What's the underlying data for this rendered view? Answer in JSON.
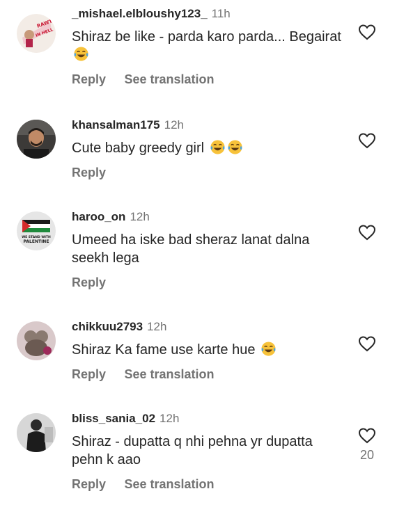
{
  "comments": [
    {
      "username": "_mishael.elbloushy123_",
      "time": "11h",
      "text": "Shiraz be like - parda karo parda... Begairat",
      "emojis": 1,
      "actions": [
        "Reply",
        "See translation"
      ],
      "like_count": "",
      "avatar_text": [
        "RAWT",
        "IN HELL"
      ]
    },
    {
      "username": "khansalman175",
      "time": "12h",
      "text": "Cute baby greedy girl",
      "emojis": 2,
      "actions": [
        "Reply"
      ],
      "like_count": ""
    },
    {
      "username": "haroo_on",
      "time": "12h",
      "text": "Umeed ha iske bad sheraz lanat dalna seekh lega",
      "emojis": 0,
      "actions": [
        "Reply"
      ],
      "like_count": "",
      "avatar_text": [
        "WE STAND WITH",
        "PALENTINE"
      ]
    },
    {
      "username": "chikkuu2793",
      "time": "12h",
      "text": "Shiraz Ka fame use karte hue",
      "emojis": 1,
      "actions": [
        "Reply",
        "See translation"
      ],
      "like_count": ""
    },
    {
      "username": "bliss_sania_02",
      "time": "12h",
      "text": "Shiraz - dupatta q nhi pehna yr dupatta pehn k aao",
      "emojis": 0,
      "actions": [
        "Reply",
        "See translation"
      ],
      "like_count": "20"
    }
  ],
  "colors": {
    "text_primary": "#262626",
    "text_secondary": "#737373",
    "emoji_face": "#f7c23a"
  },
  "icons": {
    "like": "heart-outline-icon",
    "emoji": "face-with-tears-of-joy-icon"
  }
}
